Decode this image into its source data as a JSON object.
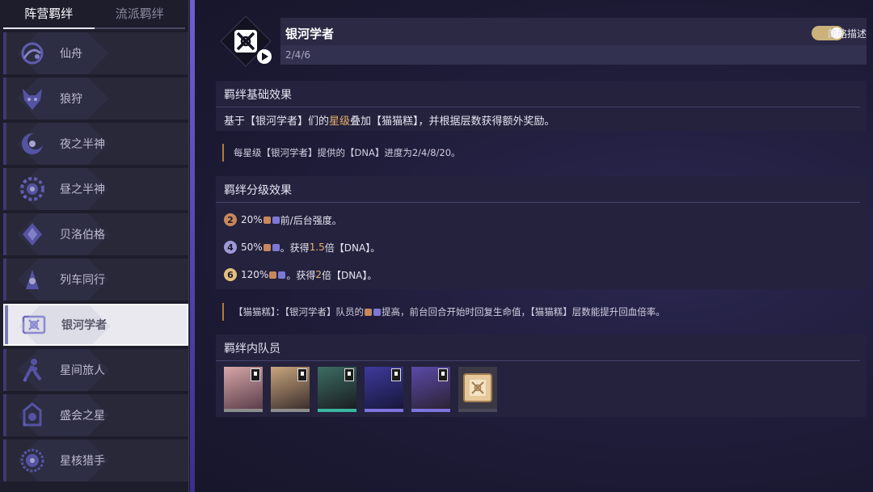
{
  "sidebar": {
    "tabs": [
      {
        "label": "阵营羁绊"
      },
      {
        "label": "流派羁绊"
      }
    ],
    "items": [
      {
        "label": "仙舟",
        "icon": "xianzhou-icon"
      },
      {
        "label": "狼狩",
        "icon": "wolf-icon"
      },
      {
        "label": "夜之半神",
        "icon": "night-demigod-icon"
      },
      {
        "label": "昼之半神",
        "icon": "day-demigod-icon"
      },
      {
        "label": "贝洛伯格",
        "icon": "belobog-icon"
      },
      {
        "label": "列车同行",
        "icon": "train-icon"
      },
      {
        "label": "银河学者",
        "icon": "galaxy-scholar-icon"
      },
      {
        "label": "星间旅人",
        "icon": "traveler-icon"
      },
      {
        "label": "盛会之星",
        "icon": "festival-star-icon"
      },
      {
        "label": "星核猎手",
        "icon": "stellaron-hunter-icon"
      }
    ]
  },
  "header": {
    "title": "银河学者",
    "sub": "2/4/6",
    "toggle_label": "简略描述"
  },
  "basic": {
    "title": "羁绊基础效果",
    "text_pre": "基于【银河学者】们的",
    "text_gold": "星级",
    "text_post": "叠加【猫猫糕】，并根据层数获得额外奖励。",
    "note": "每星级【银河学者】提供的【DNA】进度为2/4/8/20。"
  },
  "tiers": {
    "title": "羁绊分级效果",
    "rows": [
      {
        "num": "2",
        "pre": "20%",
        "post": "前/后台强度。",
        "gold": "",
        "tail": ""
      },
      {
        "num": "4",
        "pre": "50%",
        "post": "。获得",
        "gold": "1.5",
        "tail": "倍【DNA】。"
      },
      {
        "num": "6",
        "pre": "120%",
        "post": "。获得",
        "gold": "2",
        "tail": "倍【DNA】。"
      }
    ],
    "note": "【猫猫糕】：【银河学者】队员的",
    "note_tail": "提高，前台回合开始时回复生命值，【猫猫糕】层数能提升回血倍率。"
  },
  "members": {
    "title": "羁绊内队员"
  },
  "colors": {
    "gold": "#e9b36a",
    "tier2": "#c8875a",
    "tier4": "#9e9ad8",
    "tier6": "#e2c07e",
    "toggle": "#cbb27a"
  }
}
